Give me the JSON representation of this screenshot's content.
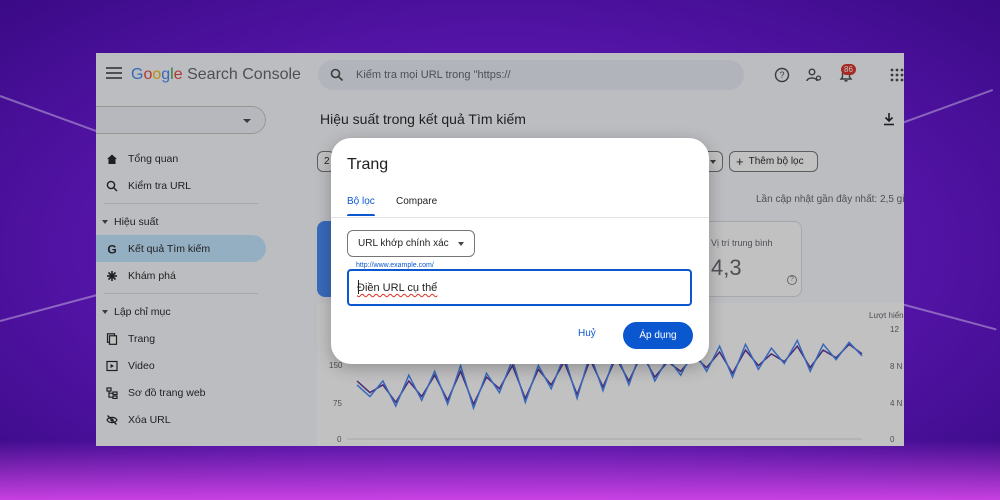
{
  "app": {
    "logo_google": "Google",
    "logo_product": "Search Console",
    "search_placeholder": "Kiểm tra mọi URL trong \"https://",
    "notification_count": "86"
  },
  "sidebar": {
    "items": [
      {
        "label": "Tổng quan",
        "icon": "home-icon"
      },
      {
        "label": "Kiểm tra URL",
        "icon": "search-icon"
      }
    ],
    "section_performance": "Hiệu suất",
    "performance_items": [
      {
        "label": "Kết quả Tìm kiếm",
        "icon": "google-g-icon",
        "active": true
      },
      {
        "label": "Khám phá",
        "icon": "asterisk-icon",
        "active": false
      }
    ],
    "section_indexing": "Lập chỉ mục",
    "indexing_items": [
      {
        "label": "Trang",
        "icon": "pages-icon"
      },
      {
        "label": "Video",
        "icon": "video-icon"
      },
      {
        "label": "Sơ đồ trang web",
        "icon": "sitemap-icon"
      },
      {
        "label": "Xóa URL",
        "icon": "eye-off-icon"
      }
    ]
  },
  "main": {
    "page_title": "Hiệu suất trong kết quả Tìm kiếm",
    "date_chip_partial": "2",
    "add_filter_label": "Thêm bộ lọc",
    "last_update": "Lần cập nhật gần đây nhất: 2,5 gi",
    "avg_position_title": "Vị trí trung bình",
    "avg_position_value": "4,3",
    "chart_right_title": "Lượt hiển",
    "left_axis": [
      "150",
      "75",
      "0"
    ],
    "right_axis": [
      "12",
      "8 N",
      "4 N",
      "0"
    ]
  },
  "chart_data": {
    "type": "line",
    "series": [
      {
        "values": [
          150,
          120,
          140,
          95,
          150,
          110,
          165,
          100,
          175,
          90,
          160,
          130,
          190,
          105,
          180,
          140,
          200,
          115,
          205,
          135,
          210,
          150,
          220,
          160,
          200,
          175,
          215,
          185,
          225,
          170,
          230,
          190,
          220,
          200,
          240,
          185,
          230,
          210,
          245,
          220
        ],
        "color": "#5c2d91"
      },
      {
        "values": [
          140,
          110,
          150,
          85,
          165,
          100,
          175,
          90,
          190,
          80,
          170,
          120,
          205,
          95,
          190,
          130,
          215,
          105,
          220,
          125,
          225,
          140,
          235,
          150,
          210,
          165,
          230,
          175,
          240,
          160,
          245,
          180,
          235,
          195,
          255,
          175,
          245,
          205,
          250,
          215
        ],
        "color": "#4285f4"
      }
    ],
    "ylim": [
      0,
      300
    ]
  },
  "dialog": {
    "title": "Trang",
    "tab_filter": "Bộ lọc",
    "tab_compare": "Compare",
    "match_type": "URL khớp chính xác",
    "url_label": "http://www.example.com/",
    "url_value": "Điền URL cụ thể",
    "cancel_label": "Huỷ",
    "apply_label": "Áp dụng"
  },
  "colors": {
    "accent": "#0b57d0",
    "active_nav": "#c2e7ff"
  }
}
